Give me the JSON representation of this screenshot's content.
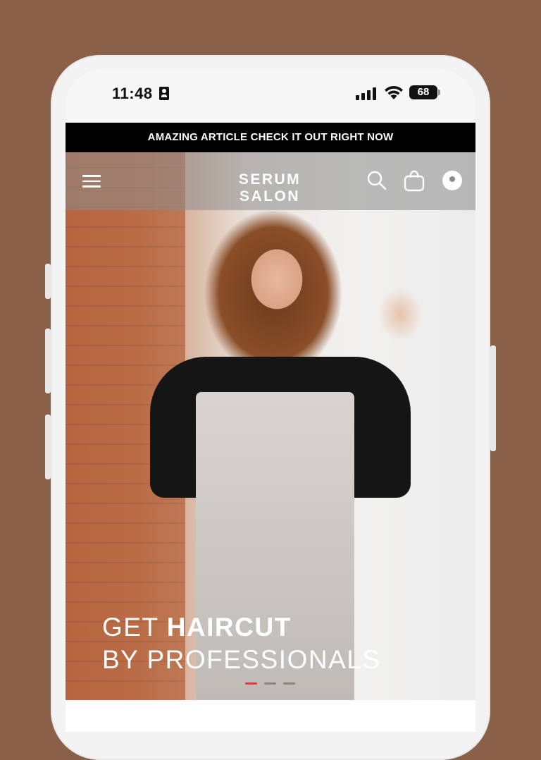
{
  "status_bar": {
    "time": "11:48",
    "battery": "68"
  },
  "announcement": {
    "text": "AMAZING ARTICLE CHECK IT OUT RIGHT NOW"
  },
  "header": {
    "brand": "SERUM SALON",
    "icons": [
      "menu-icon",
      "search-icon",
      "cart-icon",
      "account-icon"
    ]
  },
  "hero": {
    "line1_light": "GET",
    "line1_bold": "HAIRCUT",
    "line2": "BY PROFESSIONALS",
    "slides": 3,
    "active_slide": 1
  },
  "colors": {
    "background": "#8a6048",
    "announcement_bg": "#000000",
    "accent_dot": "#e0393e"
  }
}
